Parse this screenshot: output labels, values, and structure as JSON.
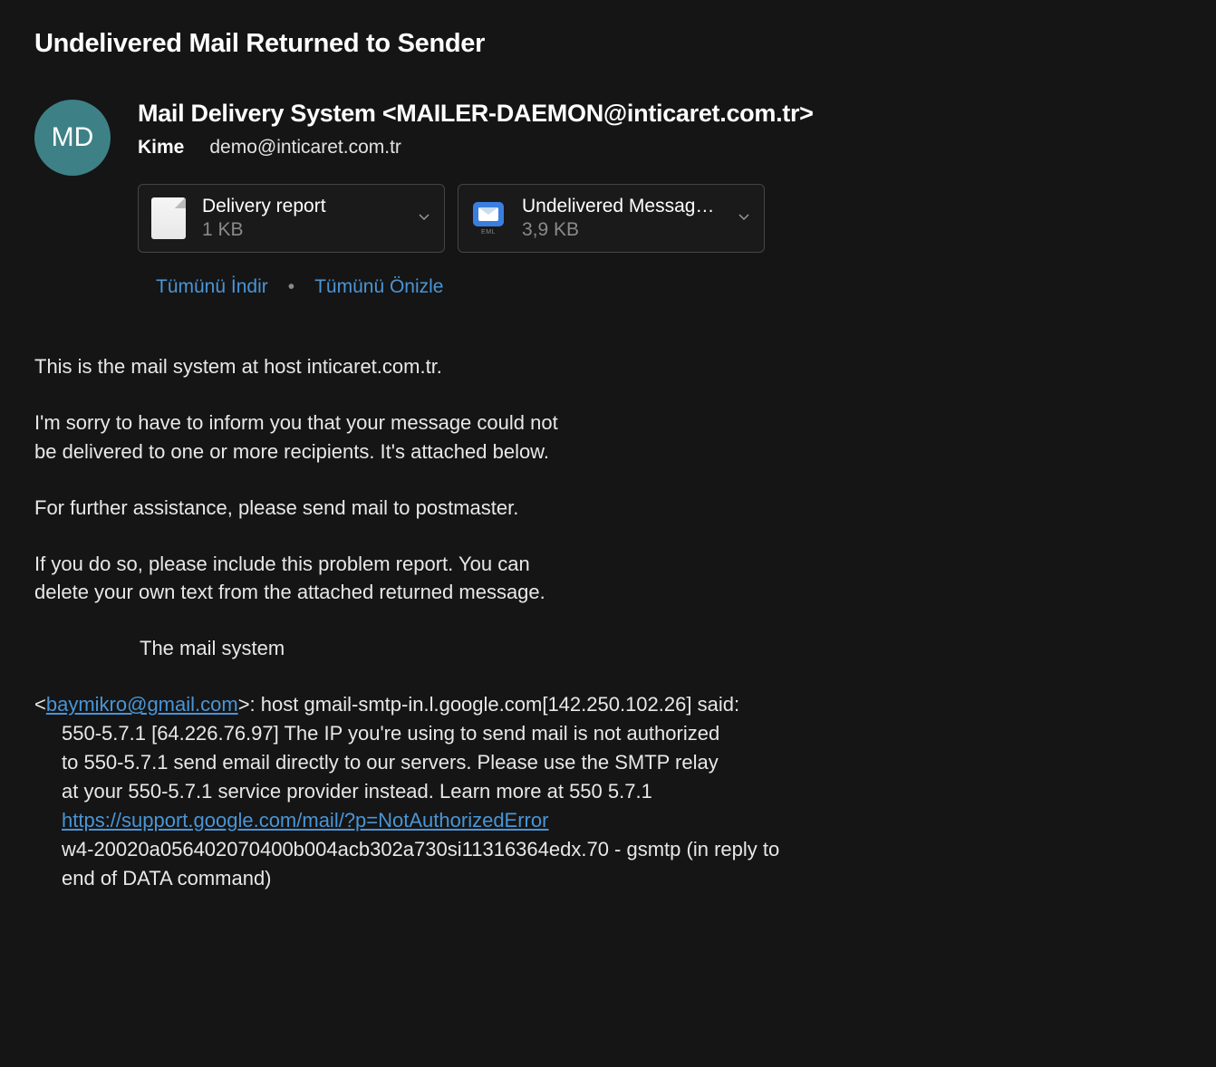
{
  "subject": "Undelivered Mail Returned to Sender",
  "avatar_initials": "MD",
  "from": "Mail Delivery System <MAILER-DAEMON@inticaret.com.tr>",
  "to_label": "Kime",
  "to_value": "demo@inticaret.com.tr",
  "attachments": [
    {
      "name": "Delivery report",
      "size": "1 KB",
      "type": "doc"
    },
    {
      "name": "Undelivered Messag…",
      "size": "3,9 KB",
      "type": "eml",
      "eml_label": "EML"
    }
  ],
  "actions": {
    "download_all": "Tümünü İndir",
    "separator": "•",
    "preview_all": "Tümünü Önizle"
  },
  "body": {
    "p1": "This is the mail system at host inticaret.com.tr.",
    "p2a": "I'm sorry to have to inform you that your message could not",
    "p2b": "be delivered to one or more recipients. It's attached below.",
    "p3": "For further assistance, please send mail to postmaster.",
    "p4a": "If you do so, please include this problem report. You can",
    "p4b": "delete your own text from the attached returned message.",
    "signature": "The mail system",
    "error": {
      "prefix": "<",
      "email": "baymikro@gmail.com",
      "after_email": ">: host gmail-smtp-in.l.google.com[142.250.102.26] said:",
      "l2": "550-5.7.1 [64.226.76.97] The IP you're using to send mail is not authorized",
      "l3": "to 550-5.7.1 send email directly to our servers. Please use the SMTP relay",
      "l4": "at your 550-5.7.1 service provider instead. Learn more at 550 5.7.1",
      "link": "https://support.google.com/mail/?p=NotAuthorizedError",
      "l6": "w4-20020a056402070400b004acb302a730si11316364edx.70 - gsmtp (in reply to",
      "l7": "end of DATA command)"
    }
  }
}
